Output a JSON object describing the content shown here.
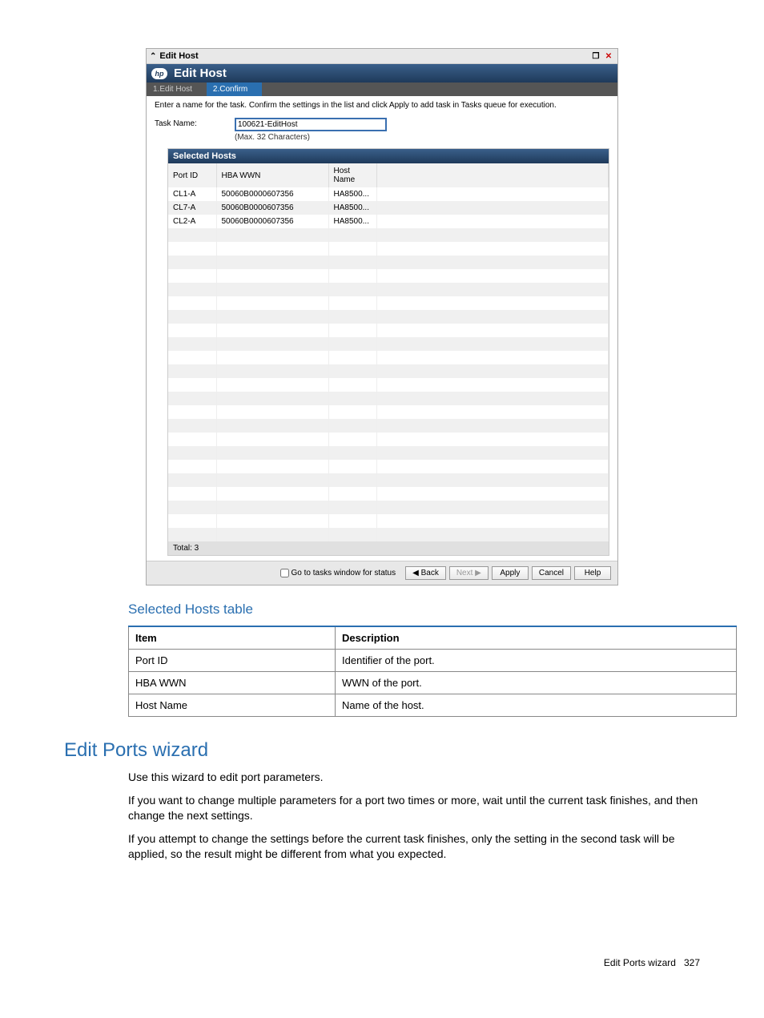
{
  "dialog": {
    "titlebar": "Edit Host",
    "header_title": "Edit Host",
    "steps": [
      "1.Edit Host",
      "2.Confirm"
    ],
    "instructions": "Enter a name for the task. Confirm the settings in the list and click Apply to add task in Tasks queue for execution.",
    "task_name_label": "Task Name:",
    "task_name_value": "100621-EditHost",
    "task_name_hint": "(Max. 32 Characters)",
    "selected_hosts_title": "Selected Hosts",
    "columns": {
      "port_id": "Port ID",
      "hba_wwn": "HBA WWN",
      "host_name": "Host Name"
    },
    "rows": [
      {
        "port_id": "CL1-A",
        "hba_wwn": "50060B0000607356",
        "host_name": "HA8500..."
      },
      {
        "port_id": "CL7-A",
        "hba_wwn": "50060B0000607356",
        "host_name": "HA8500..."
      },
      {
        "port_id": "CL2-A",
        "hba_wwn": "50060B0000607356",
        "host_name": "HA8500..."
      }
    ],
    "total_label": "Total: 3",
    "footer": {
      "tasks_checkbox_label": "Go to tasks window for status",
      "back": "Back",
      "next": "Next",
      "apply": "Apply",
      "cancel": "Cancel",
      "help": "Help"
    }
  },
  "selected_hosts_section": {
    "heading": "Selected Hosts table",
    "header_item": "Item",
    "header_desc": "Description",
    "rows": [
      {
        "item": "Port ID",
        "desc": "Identifier of the port."
      },
      {
        "item": "HBA WWN",
        "desc": "WWN of the port."
      },
      {
        "item": "Host Name",
        "desc": "Name of the host."
      }
    ]
  },
  "edit_ports": {
    "heading": "Edit Ports wizard",
    "p1": "Use this wizard to edit port parameters.",
    "p2": "If you want to change multiple parameters for a port two times or more, wait until the current task finishes, and then change the next settings.",
    "p3": "If you attempt to change the settings before the current task finishes, only the setting in the second task will be applied, so the result might be different from what you expected."
  },
  "page_footer": {
    "label": "Edit Ports wizard",
    "page_number": "327"
  }
}
